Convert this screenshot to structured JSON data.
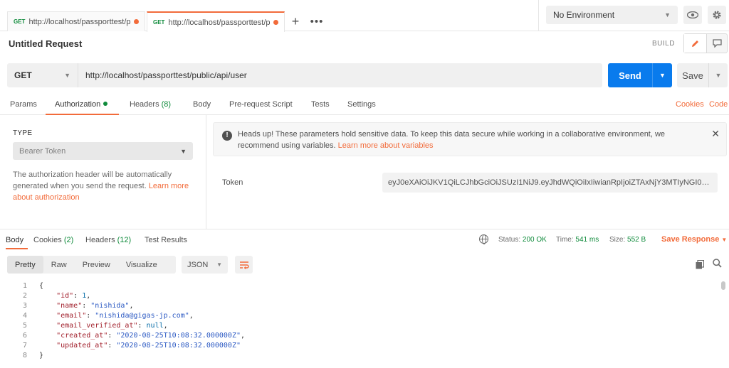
{
  "tabs": [
    {
      "method": "GET",
      "url": "http://localhost/passporttest/p..."
    },
    {
      "method": "GET",
      "url": "http://localhost/passporttest/p..."
    }
  ],
  "environment": {
    "selected": "No Environment"
  },
  "request": {
    "title": "Untitled Request",
    "mode_label": "BUILD",
    "method": "GET",
    "url": "http://localhost/passporttest/public/api/user",
    "send_label": "Send",
    "save_label": "Save"
  },
  "request_tabs": {
    "params": "Params",
    "authorization": "Authorization",
    "headers": "Headers",
    "headers_count": "(8)",
    "body": "Body",
    "prerequest": "Pre-request Script",
    "tests": "Tests",
    "settings": "Settings",
    "cookies": "Cookies",
    "code": "Code"
  },
  "auth": {
    "type_label": "TYPE",
    "type_value": "Bearer Token",
    "description": "The authorization header will be automatically generated when you send the request. ",
    "learn_more": "Learn more about authorization",
    "alert_text": "Heads up! These parameters hold sensitive data. To keep this data secure while working in a collaborative environment, we recommend using variables. ",
    "alert_link": "Learn more about variables",
    "token_label": "Token",
    "token_value": "eyJ0eXAiOiJKV1QiLCJhbGciOiJSUzI1NiJ9.eyJhdWQiOiIxIiwianRpIjoiZTAxNjY3MTIyNGI0YzUwY..."
  },
  "response_tabs": {
    "body": "Body",
    "cookies": "Cookies",
    "cookies_count": "(2)",
    "headers": "Headers",
    "headers_count": "(12)",
    "test_results": "Test Results"
  },
  "response_status": {
    "status_label": "Status:",
    "status_value": "200 OK",
    "time_label": "Time:",
    "time_value": "541 ms",
    "size_label": "Size:",
    "size_value": "552 B",
    "save_response": "Save Response"
  },
  "view_modes": [
    "Pretty",
    "Raw",
    "Preview",
    "Visualize"
  ],
  "format": "JSON",
  "code_lines": [
    {
      "n": "1",
      "text": "{"
    },
    {
      "n": "2",
      "key": "\"id\"",
      "val": "1",
      "type": "num"
    },
    {
      "n": "3",
      "key": "\"name\"",
      "val": "\"nishida\"",
      "type": "str"
    },
    {
      "n": "4",
      "key": "\"email\"",
      "val": "\"nishida@gigas-jp.com\"",
      "type": "str"
    },
    {
      "n": "5",
      "key": "\"email_verified_at\"",
      "val": "null",
      "type": "num"
    },
    {
      "n": "6",
      "key": "\"created_at\"",
      "val": "\"2020-08-25T10:08:32.000000Z\"",
      "type": "str"
    },
    {
      "n": "7",
      "key": "\"updated_at\"",
      "val": "\"2020-08-25T10:08:32.000000Z\"",
      "type": "str",
      "last": true
    },
    {
      "n": "8",
      "text": "}"
    }
  ],
  "colors": {
    "accent": "#f26b3a",
    "send": "#097bed",
    "success": "#0f8b3b"
  }
}
